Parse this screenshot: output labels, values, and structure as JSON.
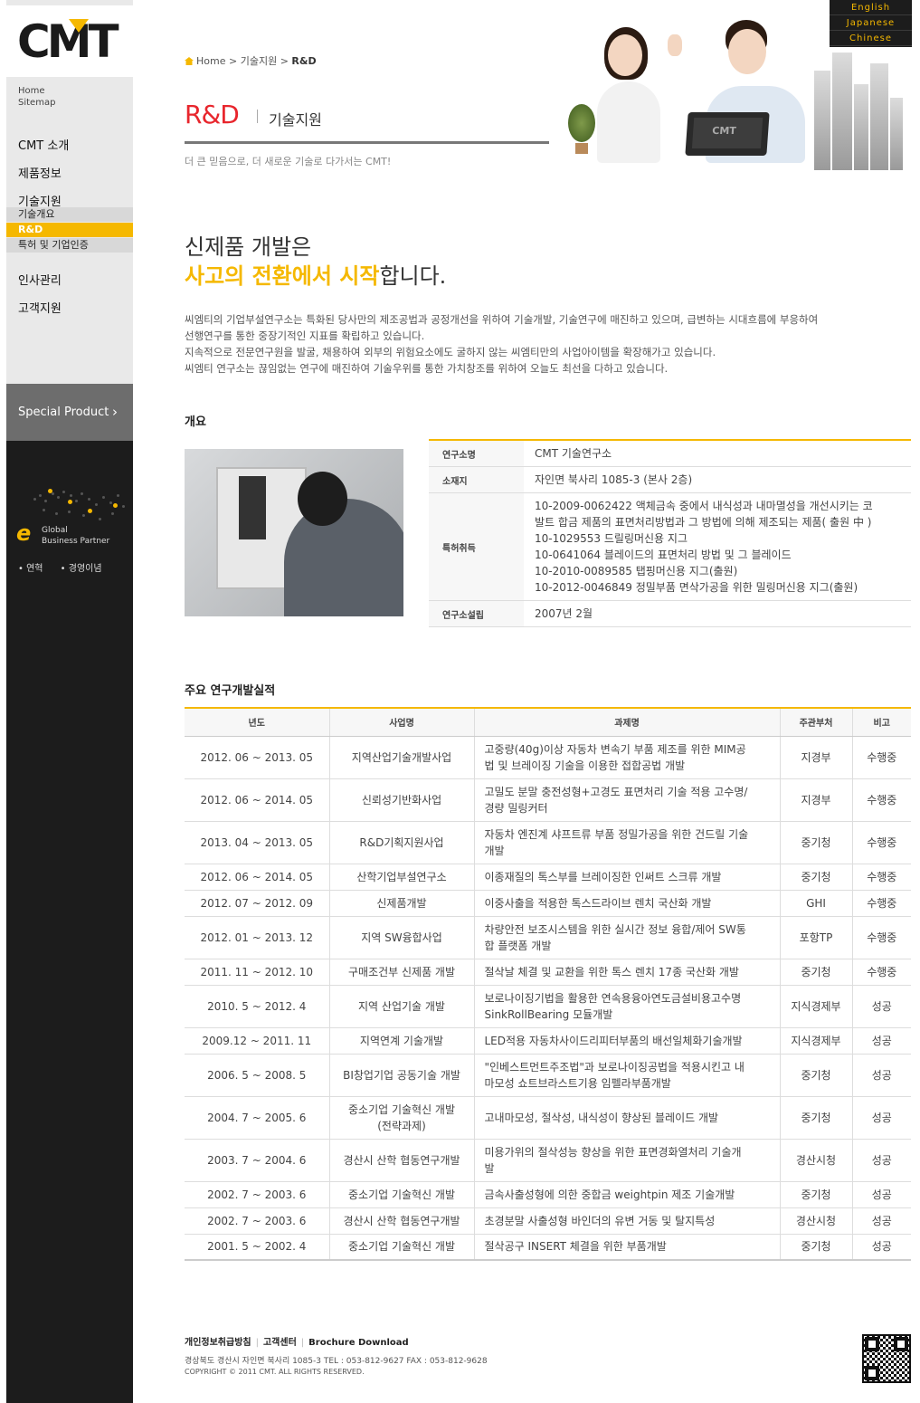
{
  "sidebar": {
    "logo_text": "CMT",
    "util": [
      "Home",
      "Sitemap"
    ],
    "menu": [
      "CMT 소개",
      "제품정보",
      "기술지원",
      "인사관리",
      "고객지원"
    ],
    "sub_menu": [
      "기술개요",
      "R&D",
      "특허 및 기업인증"
    ],
    "special_label": "Special Product",
    "global_text": [
      "Global",
      "Business Partner"
    ],
    "links": [
      "연혁",
      "경영이념"
    ]
  },
  "languages": [
    "English",
    "Japanese",
    "Chinese"
  ],
  "breadcrumb": {
    "home": "Home",
    "sep1": ">",
    "level1": "기술지원",
    "sep2": ">",
    "current": "R&D"
  },
  "header": {
    "title_en": "R&D",
    "title_ko": "기술지원",
    "slogan": "더 큰 믿음으로, 더 새로운 기술로 다가서는 CMT!"
  },
  "intro": {
    "line1": "신제품 개발은",
    "line2_highlight": "사고의 전환에서 시작",
    "line2_rest": "합니다.",
    "paragraph": [
      "씨엠티의 기업부설연구소는 특화된 당사만의 제조공법과 공정개선을 위하여 기술개발, 기술연구에 매진하고 있으며, 급변하는 시대흐름에 부응하여",
      "선행연구를 통한 중장기적인 지표를 확립하고 있습니다.",
      "지속적으로 전문연구원을 발굴, 채용하여 외부의 위험요소에도 굴하지 않는 씨엠티만의 사업아이템을 확장해가고 있습니다.",
      "씨엠티 연구소는 끊임없는 연구에 매진하여 기술우위를 통한 가치창조를 위하여 오늘도 최선을 다하고 있습니다."
    ]
  },
  "overview": {
    "title": "개요",
    "rows": [
      {
        "key": "연구소명",
        "value": [
          "CMT 기술연구소"
        ]
      },
      {
        "key": "소재지",
        "value": [
          "자인면 북사리 1085-3 (본사 2층)"
        ]
      },
      {
        "key": "특허취득",
        "value": [
          "10-2009-0062422 액체금속 중에서 내식성과 내마멸성을 개선시키는 코",
          "발트 합금 제품의 표면처리방법과 그 방법에 의해 제조되는 제품( 출원 中 )",
          "10-1029553 드릴링머신용 지그",
          "10-0641064 블레이드의 표면처리 방법 및 그 블레이드",
          "10-2010-0089585 탭핑머신용 지그(출원)",
          "10-2012-0046849 정밀부품 면삭가공을 위한 밀링머신용 지그(출원)"
        ]
      },
      {
        "key": "연구소설립",
        "value": [
          "2007년 2월"
        ]
      }
    ]
  },
  "results": {
    "title": "주요 연구개발실적",
    "headers": [
      "년도",
      "사업명",
      "과제명",
      "주관부처",
      "비고"
    ],
    "rows": [
      {
        "year": "2012. 06 ~ 2013. 05",
        "project": [
          "지역산업기술개발사업"
        ],
        "task": [
          "고중량(40g)이상 자동차 변속기 부품 제조를 위한 MIM공",
          "법 및 브레이징 기술을 이용한 접합공법 개발"
        ],
        "dept": "지경부",
        "note": "수행중"
      },
      {
        "year": "2012. 06 ~ 2014. 05",
        "project": [
          "신뢰성기반화사업"
        ],
        "task": [
          "고밀도 분말 충전성형+고경도 표면처리 기술 적용 고수명/",
          "경량 밀링커터"
        ],
        "dept": "지경부",
        "note": "수행중"
      },
      {
        "year": "2013. 04 ~ 2013. 05",
        "project": [
          "R&D기획지원사업"
        ],
        "task": [
          "자동차 엔진계 샤프트류 부품 정밀가공을 위한 건드릴 기술",
          "개발"
        ],
        "dept": "중기청",
        "note": "수행중"
      },
      {
        "year": "2012. 06 ~ 2014. 05",
        "project": [
          "산학기업부설연구소"
        ],
        "task": [
          "이종재질의 톡스부를 브레이징한 인써트 스크류 개발"
        ],
        "dept": "중기청",
        "note": "수행중"
      },
      {
        "year": "2012. 07 ~ 2012. 09",
        "project": [
          "신제품개발"
        ],
        "task": [
          "이중사출을 적용한 톡스드라이브 렌치 국산화 개발"
        ],
        "dept": "GHI",
        "note": "수행중"
      },
      {
        "year": "2012. 01 ~ 2013. 12",
        "project": [
          "지역 SW융합사업"
        ],
        "task": [
          "차량안전 보조시스템을 위한 실시간 정보 융합/제어 SW통",
          "합 플랫폼 개발"
        ],
        "dept": "포항TP",
        "note": "수행중"
      },
      {
        "year": "2011. 11 ~ 2012. 10",
        "project": [
          "구매조건부 신제품 개발"
        ],
        "task": [
          "절삭날 체결 및 교환을 위한 톡스 렌치 17종 국산화 개발"
        ],
        "dept": "중기청",
        "note": "수행중"
      },
      {
        "year": "2010. 5 ~ 2012. 4",
        "project": [
          "지역 산업기술 개발"
        ],
        "task": [
          "보로나이징기법을 활용한 연속용융아연도금설비용고수명",
          "SinkRollBearing 모듈개발"
        ],
        "dept": "지식경제부",
        "note": "성공"
      },
      {
        "year": "2009.12 ~ 2011. 11",
        "project": [
          "지역연계 기술개발"
        ],
        "task": [
          "LED적용 자동차사이드리피터부품의 배선일체화기술개발"
        ],
        "dept": "지식경제부",
        "note": "성공"
      },
      {
        "year": "2006. 5 ~ 2008. 5",
        "project": [
          "BI창업기업 공동기술 개발"
        ],
        "task": [
          "\"인베스트먼트주조법\"과 보로나이징공법을 적용시킨고 내",
          "마모성 쇼트브라스트기용 임펠라부품개발"
        ],
        "dept": "중기청",
        "note": "성공"
      },
      {
        "year": "2004. 7 ~ 2005. 6",
        "project": [
          "중소기업 기술혁신 개발",
          "(전략과제)"
        ],
        "task": [
          "고내마모성, 절삭성, 내식성이 향상된 블레이드 개발"
        ],
        "dept": "중기청",
        "note": "성공"
      },
      {
        "year": "2003. 7 ~ 2004. 6",
        "project": [
          "경산시 산학 협동연구개발"
        ],
        "task": [
          "미용가위의 절삭성능 향상을 위한 표면경화열처리 기술개",
          "발"
        ],
        "dept": "경산시청",
        "note": "성공"
      },
      {
        "year": "2002. 7 ~ 2003. 6",
        "project": [
          "중소기업 기술혁신 개발"
        ],
        "task": [
          "금속사출성형에 의한 중합금 weightpin 제조 기술개발"
        ],
        "dept": "중기청",
        "note": "성공"
      },
      {
        "year": "2002. 7 ~ 2003. 6",
        "project": [
          "경산시 산학 협동연구개발"
        ],
        "task": [
          "초경분말 사출성형 바인더의 유변 거동 및 탈지특성"
        ],
        "dept": "경산시청",
        "note": "성공"
      },
      {
        "year": "2001. 5 ~ 2002. 4",
        "project": [
          "중소기업 기술혁신 개발"
        ],
        "task": [
          "절삭공구 INSERT 체결을 위한 부품개발"
        ],
        "dept": "중기청",
        "note": "성공"
      }
    ]
  },
  "footer": {
    "links": [
      "개인정보취급방침",
      "고객센터",
      "Brochure Download"
    ],
    "address": "경상북도 경산시 자인면 북사리 1085-3    TEL : 053-812-9627    FAX : 053-812-9628",
    "copyright": "COPYRIGHT © 2011 CMT. ALL RIGHTS RESERVED."
  },
  "colors": {
    "accent": "#f5b800",
    "title_red": "#e8262d",
    "sidebar_dark": "#1c1c1c"
  }
}
